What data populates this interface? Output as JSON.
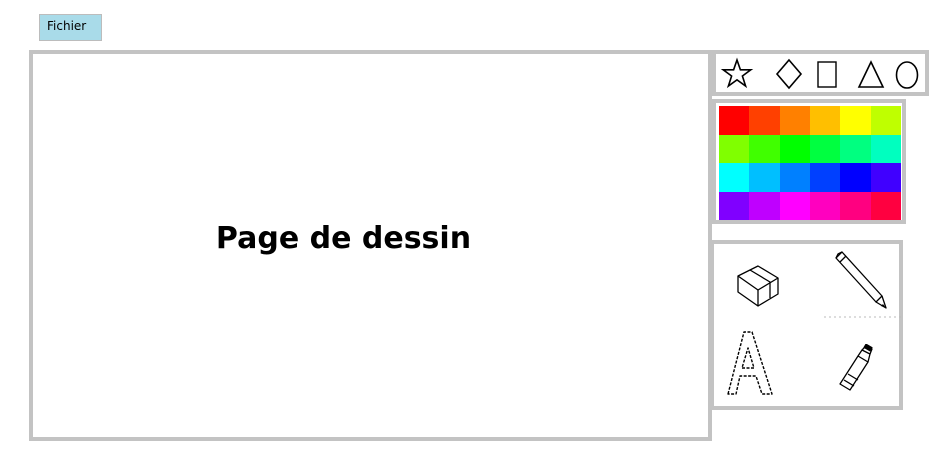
{
  "menu": {
    "file_label": "Fichier"
  },
  "canvas": {
    "title": "Page de dessin"
  },
  "shapes": [
    "star",
    "diamond",
    "rectangle",
    "triangle",
    "ellipse"
  ],
  "palette": {
    "colors": [
      "#ff0000",
      "#ff4000",
      "#ff8000",
      "#ffbf00",
      "#ffff00",
      "#bfff00",
      "#80ff00",
      "#40ff00",
      "#00ff00",
      "#00ff40",
      "#00ff80",
      "#00ffbf",
      "#00ffff",
      "#00bfff",
      "#0080ff",
      "#0040ff",
      "#0000ff",
      "#4000ff",
      "#8000ff",
      "#bf00ff",
      "#ff00ff",
      "#ff00bf",
      "#ff0080",
      "#ff0040"
    ]
  },
  "tools": [
    "eraser",
    "pencil",
    "text",
    "paint-tube"
  ],
  "colors": {
    "menu_bg": "#a9dbe9",
    "panel_border": "#c3c3c3"
  }
}
